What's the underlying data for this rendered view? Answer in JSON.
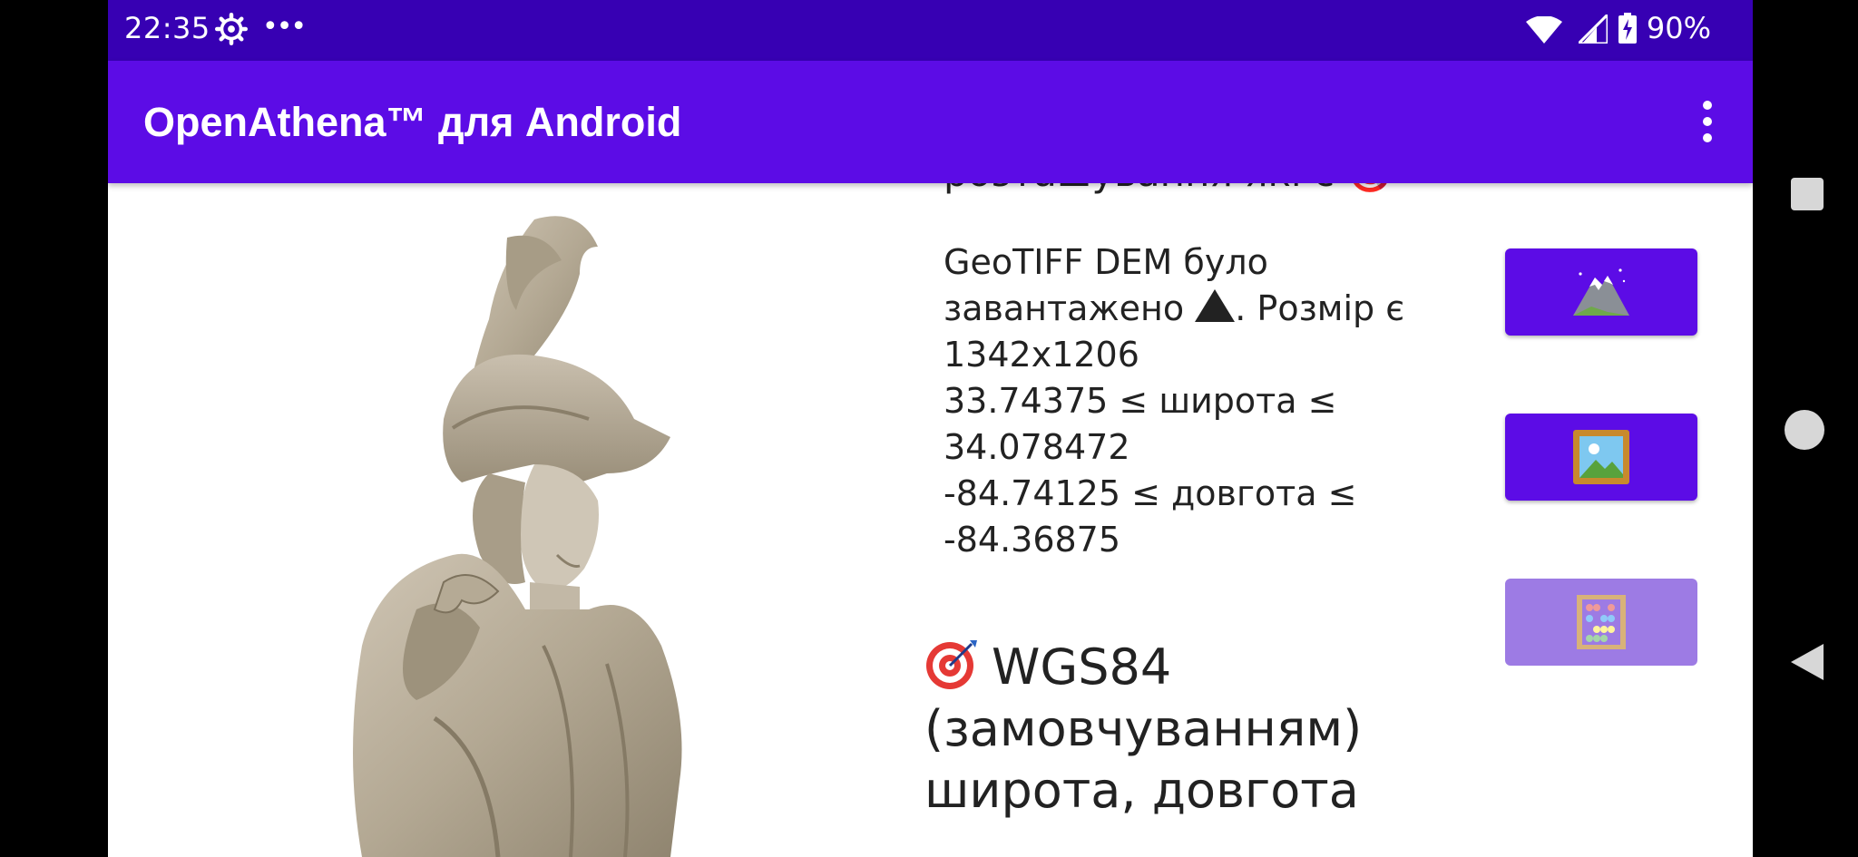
{
  "status_bar": {
    "time": "22:35",
    "dots": "•••",
    "battery_percent": "90%",
    "icons": [
      "gear-icon",
      "wifi-icon",
      "signal-icon",
      "battery-charging-icon"
    ]
  },
  "app_bar": {
    "title": "OpenAthena™ для Android",
    "menu_icon": "overflow-menu-icon"
  },
  "main": {
    "cut_off_text": "розташування які є 🎯",
    "dem_info": {
      "line1": "GeoTIFF DEM було",
      "line2_prefix": "завантажено",
      "line2_suffix": ". Розмір є",
      "line3": "1342x1206",
      "line4": "33.74375 ≤ широта ≤",
      "line5": "34.078472",
      "line6": "-84.74125 ≤ довгота ≤",
      "line7": "-84.36875"
    },
    "wgs_block": {
      "line1": "WGS84",
      "line2": "(замовчуванням)",
      "line3": "широта, довгота"
    },
    "buttons": [
      {
        "name": "load-dem-button",
        "icon": "mountain-icon",
        "enabled": true
      },
      {
        "name": "load-image-button",
        "icon": "framed-picture-icon",
        "enabled": true
      },
      {
        "name": "calculate-button",
        "icon": "abacus-icon",
        "enabled": false
      }
    ]
  },
  "colors": {
    "status_bar": "#3700b3",
    "app_bar": "#5c0ce6",
    "button": "#5c0ce6",
    "button_disabled": "#9d7be4"
  },
  "nav_bar": {
    "icons": [
      "recents-icon",
      "home-icon",
      "back-icon"
    ]
  }
}
